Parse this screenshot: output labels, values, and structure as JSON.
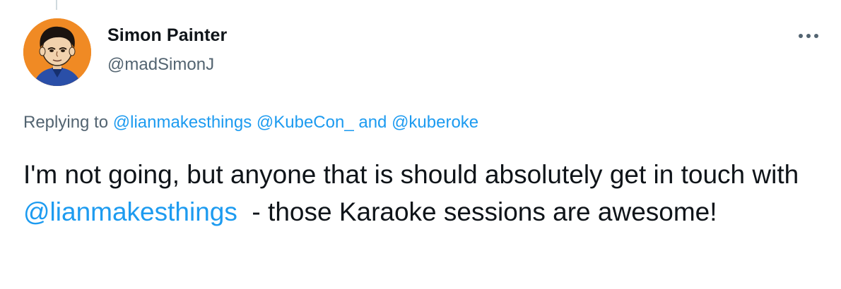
{
  "tweet": {
    "author_name": "Simon Painter",
    "author_handle": "@madSimonJ",
    "reply_prefix": "Replying to",
    "reply_mentions": [
      "@lianmakesthings",
      "@KubeCon_",
      "@kuberoke"
    ],
    "reply_joiner": "and",
    "text_part1": "I'm not going, but anyone that is should absolutely get in touch with",
    "text_mention": "@lianmakesthings",
    "text_part2": "  - those Karaoke sessions are awesome!"
  },
  "icons": {
    "more": "more-horizontal-icon",
    "avatar": "cartoon-avatar"
  },
  "colors": {
    "link": "#1d9bf0",
    "secondary_text": "#536471",
    "primary_text": "#0f1419",
    "avatar_bg": "#f08a24"
  }
}
